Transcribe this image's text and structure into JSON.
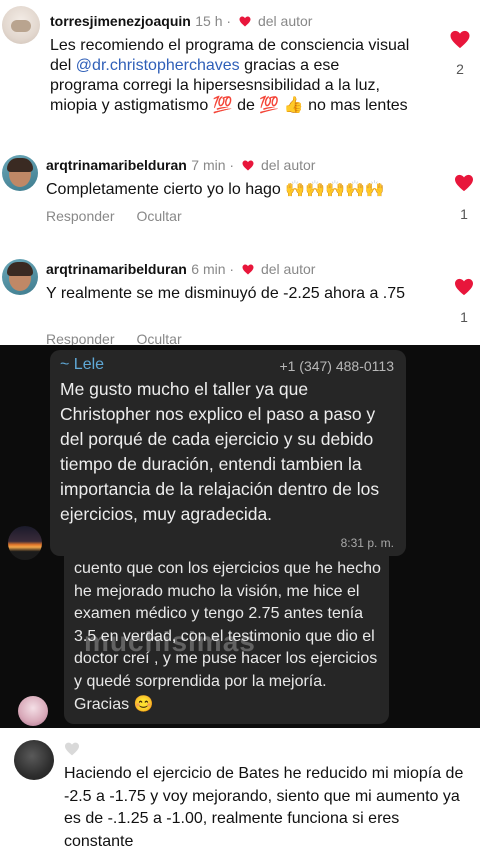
{
  "comments": [
    {
      "username": "torresjimenezjoaquin",
      "time": "15 h",
      "author_label": "del autor",
      "text_before": "Les recomiendo el programa de consciencia visual del ",
      "mention": "@dr.christopherchaves",
      "text_after": " gracias a ese programa corregi la hipersesnsibilidad a la luz, miopia y astigmatismo 💯 de 💯 👍 no mas lentes",
      "likes": "2"
    },
    {
      "username": "arqtrinamaribelduran",
      "time": "7 min",
      "author_label": "del autor",
      "text": "Completamente cierto yo lo hago 🙌🙌🙌🙌🙌",
      "reply": "Responder",
      "hide": "Ocultar",
      "likes": "1"
    },
    {
      "username": "arqtrinamaribelduran",
      "time": "6 min",
      "author_label": "del autor",
      "text": "Y realmente se me disminuyó de -2.25 ahora a .75",
      "reply": "Responder",
      "hide": "Ocultar",
      "likes": "1"
    }
  ],
  "whatsapp": {
    "message1": {
      "sender": "~ Lele",
      "phone": "+1 (347) 488-0113",
      "text": "Me gusto mucho el taller ya que Christopher nos explico el paso a paso y del porqué de cada ejercicio y su debido tiempo de duración, entendi tambien la importancia de la relajación dentro de los ejercicios, muy agradecida.",
      "time": "8:31 p. m."
    },
    "message2": {
      "text": "cuento que con los ejercicios que he hecho he mejorado mucho la visión, me hice el examen médico y tengo 2.75 antes tenía  3.5 en verdad, con el testimonio que dio el doctor creí , y me puse hacer los ejercicios y quedé sorprendida por la mejoría. Gracias 😊"
    },
    "watermark": "muchisimas"
  },
  "bottom_comment": {
    "text": "Haciendo el ejercicio de Bates he reducido mi miopía de -2.5 a -1.75 y voy mejorando, siento que mi aumento ya es de -.1.25 a -1.00, realmente funciona si eres constante"
  },
  "colors": {
    "like_red": "#e8163b",
    "mention_blue": "#2f5fb8",
    "wa_bubble": "#262626",
    "wa_sender": "#5fa8d6"
  }
}
